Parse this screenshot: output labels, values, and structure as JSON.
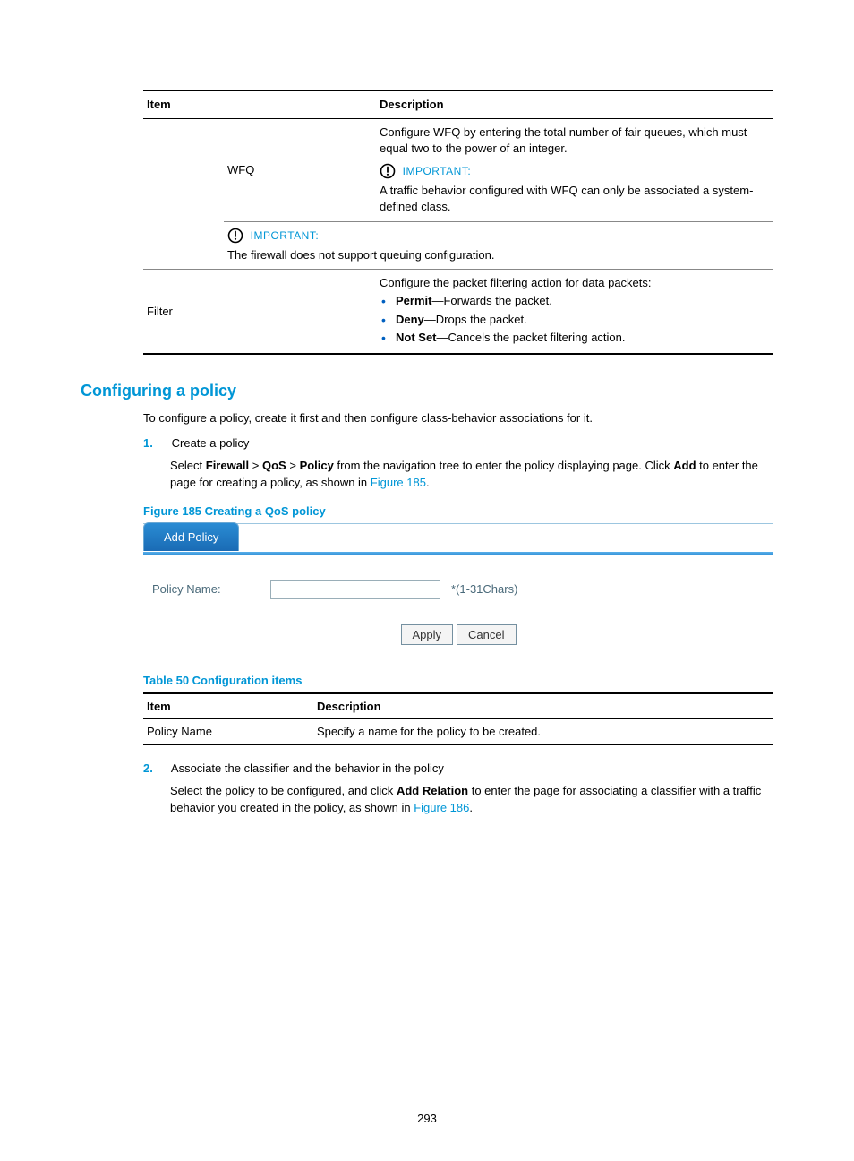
{
  "table1": {
    "headers": {
      "item": "Item",
      "description": "Description"
    },
    "wfq": {
      "label": "WFQ",
      "desc1": "Configure WFQ by entering the total number of fair queues, which must equal two to the power of an integer.",
      "important_label": "IMPORTANT:",
      "desc2": "A traffic behavior configured with WFQ can only be associated a system-defined class."
    },
    "important2": {
      "label": "IMPORTANT:",
      "text": "The firewall does not support queuing configuration."
    },
    "filter": {
      "label": "Filter",
      "intro": "Configure the packet filtering action for data packets:",
      "items": [
        {
          "bold": "Permit",
          "rest": "—Forwards the packet."
        },
        {
          "bold": "Deny",
          "rest": "—Drops the packet."
        },
        {
          "bold": "Not Set",
          "rest": "—Cancels the packet filtering action."
        }
      ]
    }
  },
  "heading": "Configuring a policy",
  "intro": "To configure a policy, create it first and then configure class-behavior associations for it.",
  "step1": {
    "num": "1.",
    "title": "Create a policy",
    "p1_a": "Select ",
    "p1_b1": "Firewall",
    "p1_sep": " > ",
    "p1_b2": "QoS",
    "p1_b3": "Policy",
    "p1_c": " from the navigation tree to enter the policy displaying page. Click ",
    "p1_b4": "Add",
    "p1_d": " to enter the page for creating a policy, as shown in ",
    "p1_link": "Figure 185",
    "p1_e": "."
  },
  "figure185": {
    "caption": "Figure 185 Creating a QoS policy",
    "tab": "Add Policy",
    "label": "Policy Name:",
    "hint": "*(1-31Chars)",
    "apply": "Apply",
    "cancel": "Cancel"
  },
  "table50": {
    "caption": "Table 50 Configuration items",
    "headers": {
      "item": "Item",
      "description": "Description"
    },
    "row": {
      "item": "Policy Name",
      "desc": "Specify a name for the policy to be created."
    }
  },
  "step2": {
    "num": "2.",
    "title": "Associate the classifier and the behavior in the policy",
    "p1_a": "Select the policy to be configured, and click ",
    "p1_b": "Add Relation",
    "p1_c": " to enter the page for associating a classifier with a traffic behavior you created in the policy, as shown in ",
    "p1_link": "Figure 186",
    "p1_d": "."
  },
  "page_number": "293"
}
